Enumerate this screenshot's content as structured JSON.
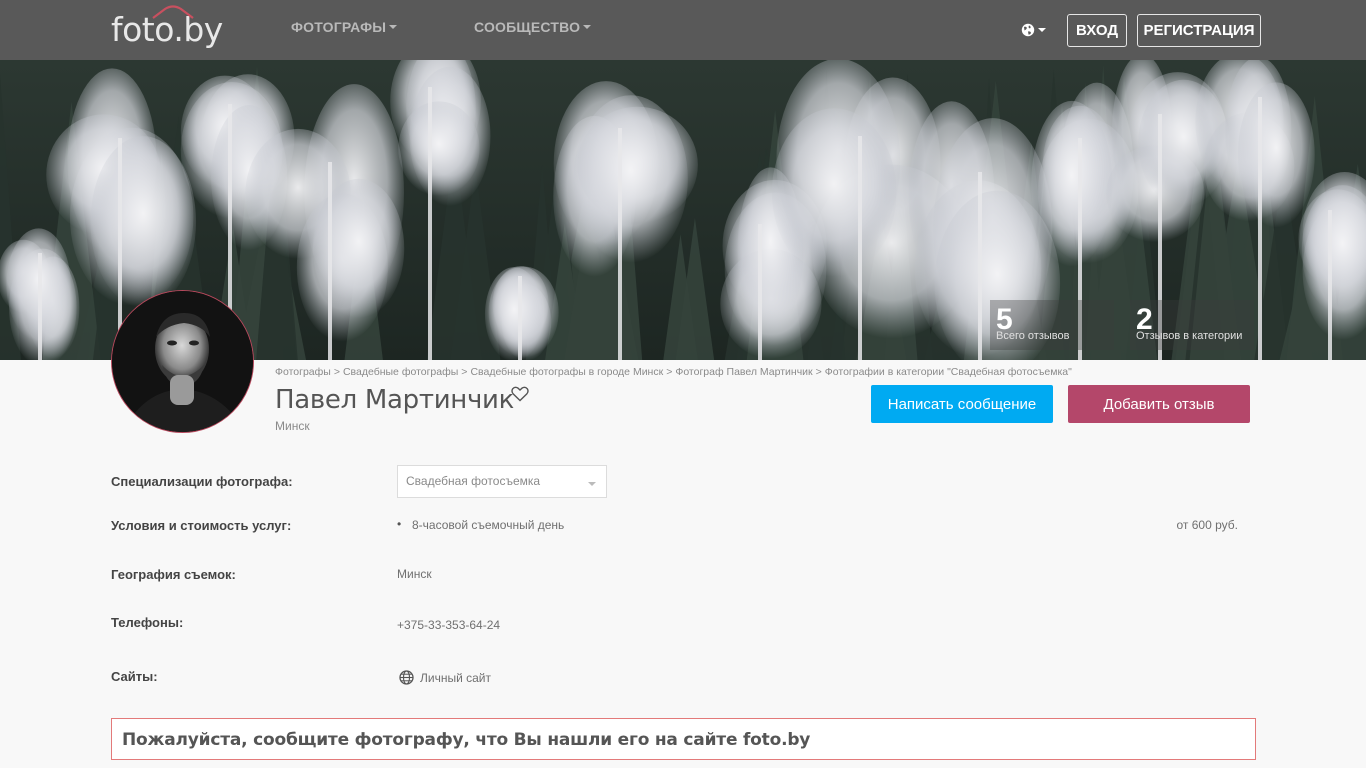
{
  "header": {
    "logo_text": "foto.by",
    "menu": [
      {
        "label": "Фотографы"
      },
      {
        "label": "Сообщество"
      }
    ],
    "login_label": "Вход",
    "register_label": "Регистрация"
  },
  "stats": [
    {
      "value": "5",
      "label": "Всего отзывов"
    },
    {
      "value": "2",
      "label": "Отзывов в категории"
    }
  ],
  "breadcrumb": [
    "Фотографы",
    "Свадебные фотографы",
    "Свадебные фотографы в городе Минск",
    "Фотограф Павел Мартинчик",
    "Фотографии в категории \"Свадебная фотосъемка\""
  ],
  "breadcrumb_separator": ">",
  "profile": {
    "name": "Павел Мартинчик",
    "city": "Минск",
    "message_button": "Написать сообщение",
    "review_button": "Добавить отзыв"
  },
  "info": {
    "specializations_label": "Специализации фотографа:",
    "specialization_selected": "Свадебная фотосъемка",
    "services_label": "Условия и стоимость услуг:",
    "service_name": "8-часовой съемочный день",
    "service_price": "от 600 руб.",
    "geography_label": "География съемок:",
    "geography_value": "Минск",
    "phones_label": "Телефоны:",
    "phone_value": "+375-33-353-64-24",
    "sites_label": "Сайты:",
    "site_link": "Личный сайт"
  },
  "notice": "Пожалуйста, сообщите фотографу, что Вы нашли его на сайте foto.by",
  "colors": {
    "navbar": "#595959",
    "message_button": "#00aaf2",
    "review_button": "#b4476a",
    "notice_border": "#e37a7a"
  }
}
